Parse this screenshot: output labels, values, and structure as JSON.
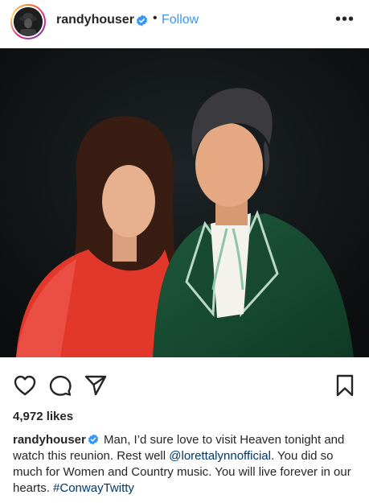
{
  "header": {
    "username": "randyhouser",
    "separator": "•",
    "follow_label": "Follow",
    "more_label": "•••"
  },
  "icons": {
    "verified": "verified-badge-icon",
    "like": "heart-icon",
    "comment": "comment-icon",
    "share": "send-icon",
    "save": "bookmark-icon",
    "more": "more-options-icon"
  },
  "colors": {
    "accent": "#3897f0",
    "link": "#00376b",
    "text": "#262626"
  },
  "post": {
    "likes_text": "4,972 likes",
    "caption": {
      "username": "randyhouser",
      "text_before_mention": "Man, I’d sure love to visit Heaven tonight and watch this reunion. Rest well ",
      "mention": "@lorettalynnofficial",
      "text_after_mention": ". You did so much for Women and Country music. You will live forever in our hearts. ",
      "hashtag": "#ConwayTwitty"
    }
  }
}
